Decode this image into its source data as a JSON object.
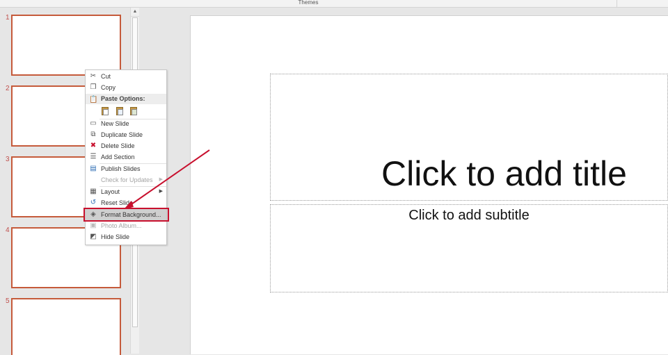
{
  "ribbon": {
    "group_label": "Themes"
  },
  "thumbnails": [
    {
      "number": "1"
    },
    {
      "number": "2"
    },
    {
      "number": "3"
    },
    {
      "number": "4"
    },
    {
      "number": "5"
    }
  ],
  "slide": {
    "title_placeholder": "Click to add title",
    "subtitle_placeholder": "Click to add subtitle"
  },
  "context_menu": {
    "cut": "Cut",
    "copy": "Copy",
    "paste_options": "Paste Options:",
    "new_slide": "New Slide",
    "duplicate_slide": "Duplicate Slide",
    "delete_slide": "Delete Slide",
    "add_section": "Add Section",
    "publish_slides": "Publish Slides",
    "check_for_updates": "Check for Updates",
    "layout": "Layout",
    "reset_slide": "Reset Slide",
    "format_background": "Format Background...",
    "photo_album": "Photo Album...",
    "hide_slide": "Hide Slide"
  },
  "colors": {
    "thumb_border": "#c55a3a",
    "annotation": "#c8102e"
  }
}
